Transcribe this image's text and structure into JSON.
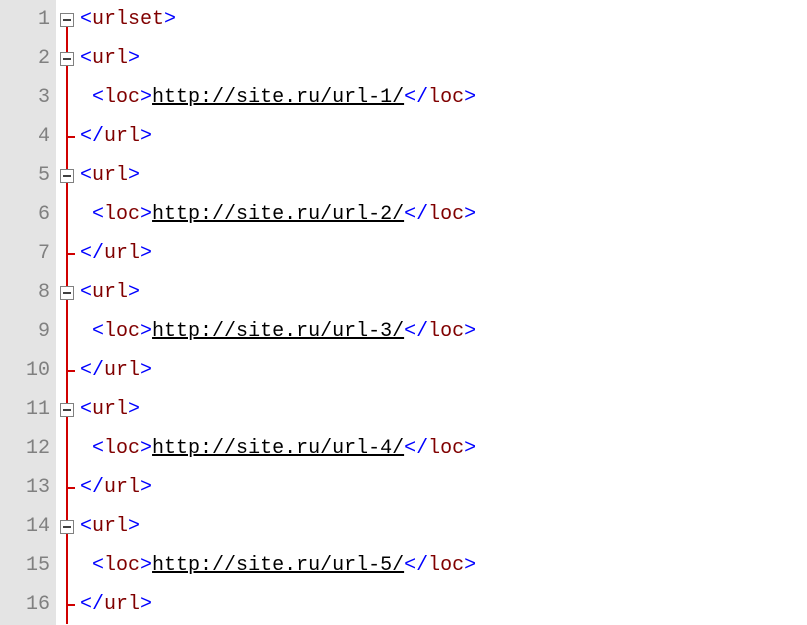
{
  "lines": {
    "numbers": [
      "1",
      "2",
      "3",
      "4",
      "5",
      "6",
      "7",
      "8",
      "9",
      "10",
      "11",
      "12",
      "13",
      "14",
      "15",
      "16"
    ]
  },
  "code": {
    "urlset_open": "urlset",
    "url_open": "url",
    "url_close": "url",
    "loc": "loc",
    "urls": {
      "u1": "http://site.ru/url-1/",
      "u2": "http://site.ru/url-2/",
      "u3": "http://site.ru/url-3/",
      "u4": "http://site.ru/url-4/",
      "u5": "http://site.ru/url-5/"
    }
  },
  "brackets": {
    "lt": "<",
    "gt": ">",
    "lts": "</"
  }
}
